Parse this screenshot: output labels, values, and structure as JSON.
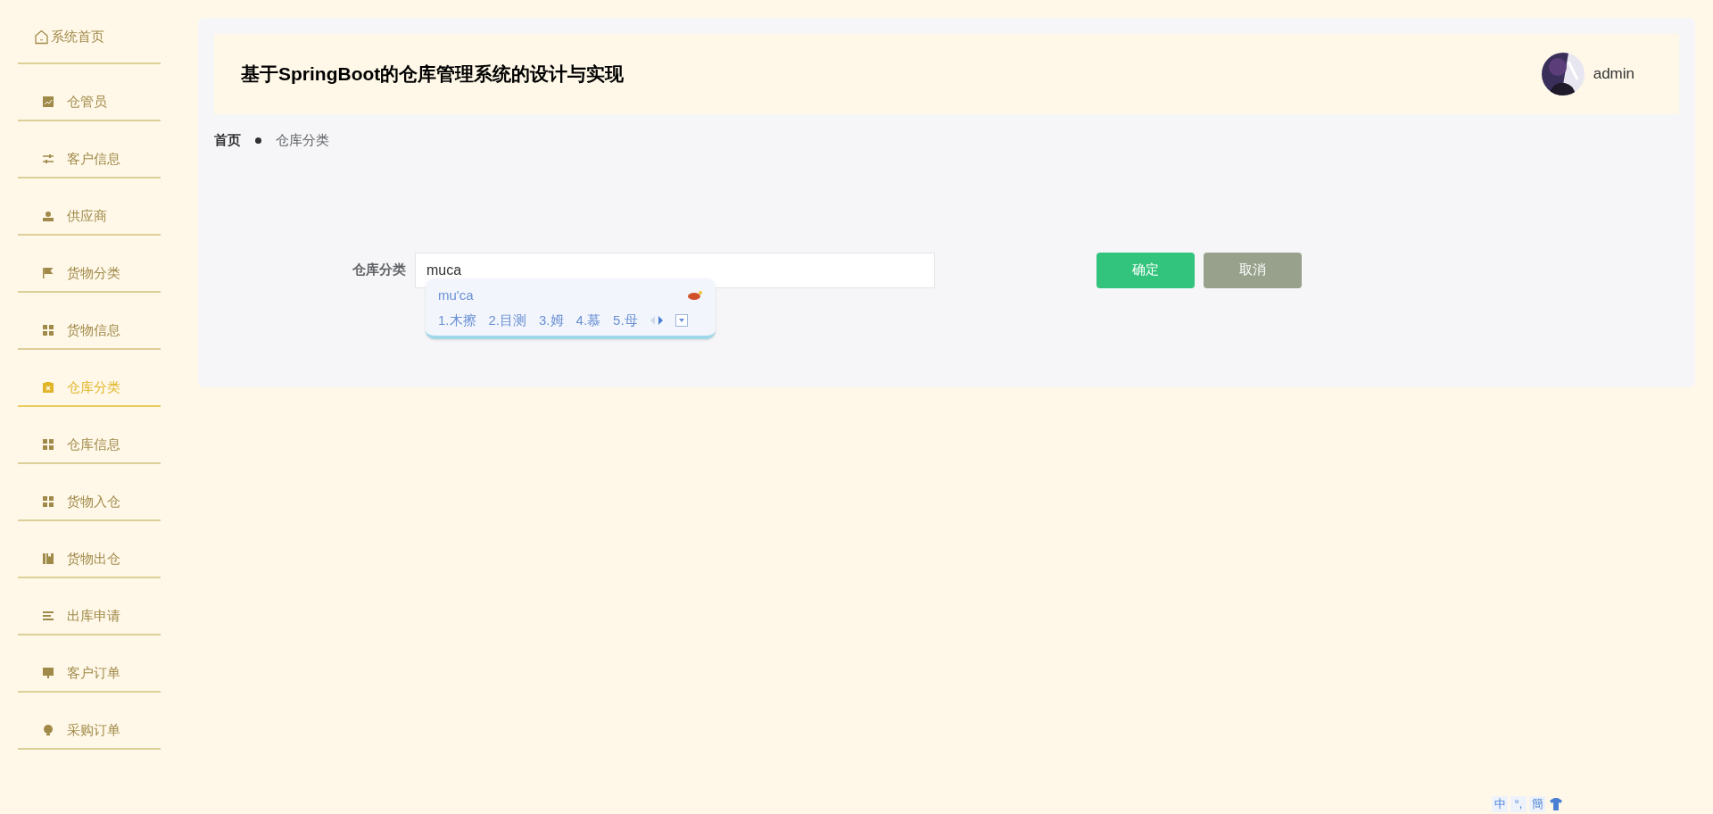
{
  "sidebar": {
    "home": {
      "label": "系统首页"
    },
    "items": [
      {
        "label": "仓管员",
        "selected": false
      },
      {
        "label": "客户信息",
        "selected": false
      },
      {
        "label": "供应商",
        "selected": false
      },
      {
        "label": "货物分类",
        "selected": false
      },
      {
        "label": "货物信息",
        "selected": false
      },
      {
        "label": "仓库分类",
        "selected": true
      },
      {
        "label": "仓库信息",
        "selected": false
      },
      {
        "label": "货物入仓",
        "selected": false
      },
      {
        "label": "货物出仓",
        "selected": false
      },
      {
        "label": "出库申请",
        "selected": false
      },
      {
        "label": "客户订单",
        "selected": false
      },
      {
        "label": "采购订单",
        "selected": false
      }
    ]
  },
  "header": {
    "title": "基于SpringBoot的仓库管理系统的设计与实现",
    "user": "admin"
  },
  "breadcrumb": [
    "首页",
    "仓库分类"
  ],
  "form": {
    "label": "仓库分类",
    "value": "muca",
    "buttons": [
      {
        "label": "确定",
        "kind": "primary"
      },
      {
        "label": "取消",
        "kind": "secondary"
      }
    ]
  },
  "ime": {
    "composition": "mu'ca",
    "candidates": [
      "1.木擦",
      "2.目测",
      "3.姆",
      "4.慕",
      "5.母"
    ],
    "toolbar": [
      "中",
      "°,",
      "簡"
    ]
  }
}
